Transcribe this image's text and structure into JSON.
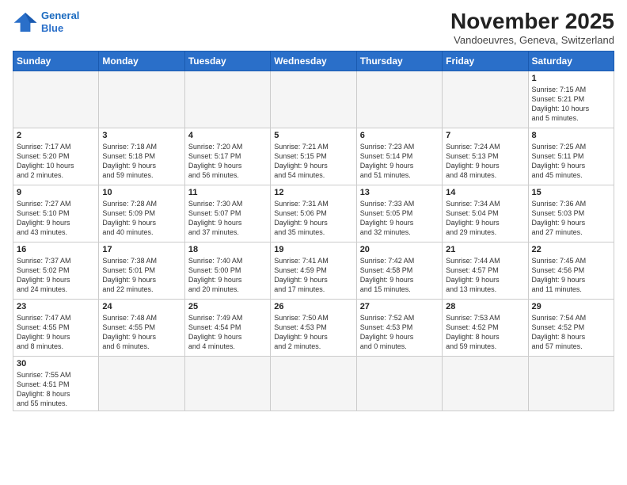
{
  "logo": {
    "line1": "General",
    "line2": "Blue"
  },
  "header": {
    "title": "November 2025",
    "subtitle": "Vandoeuvres, Geneva, Switzerland"
  },
  "weekdays": [
    "Sunday",
    "Monday",
    "Tuesday",
    "Wednesday",
    "Thursday",
    "Friday",
    "Saturday"
  ],
  "weeks": [
    [
      {
        "num": "",
        "info": ""
      },
      {
        "num": "",
        "info": ""
      },
      {
        "num": "",
        "info": ""
      },
      {
        "num": "",
        "info": ""
      },
      {
        "num": "",
        "info": ""
      },
      {
        "num": "",
        "info": ""
      },
      {
        "num": "1",
        "info": "Sunrise: 7:15 AM\nSunset: 5:21 PM\nDaylight: 10 hours\nand 5 minutes."
      }
    ],
    [
      {
        "num": "2",
        "info": "Sunrise: 7:17 AM\nSunset: 5:20 PM\nDaylight: 10 hours\nand 2 minutes."
      },
      {
        "num": "3",
        "info": "Sunrise: 7:18 AM\nSunset: 5:18 PM\nDaylight: 9 hours\nand 59 minutes."
      },
      {
        "num": "4",
        "info": "Sunrise: 7:20 AM\nSunset: 5:17 PM\nDaylight: 9 hours\nand 56 minutes."
      },
      {
        "num": "5",
        "info": "Sunrise: 7:21 AM\nSunset: 5:15 PM\nDaylight: 9 hours\nand 54 minutes."
      },
      {
        "num": "6",
        "info": "Sunrise: 7:23 AM\nSunset: 5:14 PM\nDaylight: 9 hours\nand 51 minutes."
      },
      {
        "num": "7",
        "info": "Sunrise: 7:24 AM\nSunset: 5:13 PM\nDaylight: 9 hours\nand 48 minutes."
      },
      {
        "num": "8",
        "info": "Sunrise: 7:25 AM\nSunset: 5:11 PM\nDaylight: 9 hours\nand 45 minutes."
      }
    ],
    [
      {
        "num": "9",
        "info": "Sunrise: 7:27 AM\nSunset: 5:10 PM\nDaylight: 9 hours\nand 43 minutes."
      },
      {
        "num": "10",
        "info": "Sunrise: 7:28 AM\nSunset: 5:09 PM\nDaylight: 9 hours\nand 40 minutes."
      },
      {
        "num": "11",
        "info": "Sunrise: 7:30 AM\nSunset: 5:07 PM\nDaylight: 9 hours\nand 37 minutes."
      },
      {
        "num": "12",
        "info": "Sunrise: 7:31 AM\nSunset: 5:06 PM\nDaylight: 9 hours\nand 35 minutes."
      },
      {
        "num": "13",
        "info": "Sunrise: 7:33 AM\nSunset: 5:05 PM\nDaylight: 9 hours\nand 32 minutes."
      },
      {
        "num": "14",
        "info": "Sunrise: 7:34 AM\nSunset: 5:04 PM\nDaylight: 9 hours\nand 29 minutes."
      },
      {
        "num": "15",
        "info": "Sunrise: 7:36 AM\nSunset: 5:03 PM\nDaylight: 9 hours\nand 27 minutes."
      }
    ],
    [
      {
        "num": "16",
        "info": "Sunrise: 7:37 AM\nSunset: 5:02 PM\nDaylight: 9 hours\nand 24 minutes."
      },
      {
        "num": "17",
        "info": "Sunrise: 7:38 AM\nSunset: 5:01 PM\nDaylight: 9 hours\nand 22 minutes."
      },
      {
        "num": "18",
        "info": "Sunrise: 7:40 AM\nSunset: 5:00 PM\nDaylight: 9 hours\nand 20 minutes."
      },
      {
        "num": "19",
        "info": "Sunrise: 7:41 AM\nSunset: 4:59 PM\nDaylight: 9 hours\nand 17 minutes."
      },
      {
        "num": "20",
        "info": "Sunrise: 7:42 AM\nSunset: 4:58 PM\nDaylight: 9 hours\nand 15 minutes."
      },
      {
        "num": "21",
        "info": "Sunrise: 7:44 AM\nSunset: 4:57 PM\nDaylight: 9 hours\nand 13 minutes."
      },
      {
        "num": "22",
        "info": "Sunrise: 7:45 AM\nSunset: 4:56 PM\nDaylight: 9 hours\nand 11 minutes."
      }
    ],
    [
      {
        "num": "23",
        "info": "Sunrise: 7:47 AM\nSunset: 4:55 PM\nDaylight: 9 hours\nand 8 minutes."
      },
      {
        "num": "24",
        "info": "Sunrise: 7:48 AM\nSunset: 4:55 PM\nDaylight: 9 hours\nand 6 minutes."
      },
      {
        "num": "25",
        "info": "Sunrise: 7:49 AM\nSunset: 4:54 PM\nDaylight: 9 hours\nand 4 minutes."
      },
      {
        "num": "26",
        "info": "Sunrise: 7:50 AM\nSunset: 4:53 PM\nDaylight: 9 hours\nand 2 minutes."
      },
      {
        "num": "27",
        "info": "Sunrise: 7:52 AM\nSunset: 4:53 PM\nDaylight: 9 hours\nand 0 minutes."
      },
      {
        "num": "28",
        "info": "Sunrise: 7:53 AM\nSunset: 4:52 PM\nDaylight: 8 hours\nand 59 minutes."
      },
      {
        "num": "29",
        "info": "Sunrise: 7:54 AM\nSunset: 4:52 PM\nDaylight: 8 hours\nand 57 minutes."
      }
    ],
    [
      {
        "num": "30",
        "info": "Sunrise: 7:55 AM\nSunset: 4:51 PM\nDaylight: 8 hours\nand 55 minutes."
      },
      {
        "num": "",
        "info": ""
      },
      {
        "num": "",
        "info": ""
      },
      {
        "num": "",
        "info": ""
      },
      {
        "num": "",
        "info": ""
      },
      {
        "num": "",
        "info": ""
      },
      {
        "num": "",
        "info": ""
      }
    ]
  ]
}
